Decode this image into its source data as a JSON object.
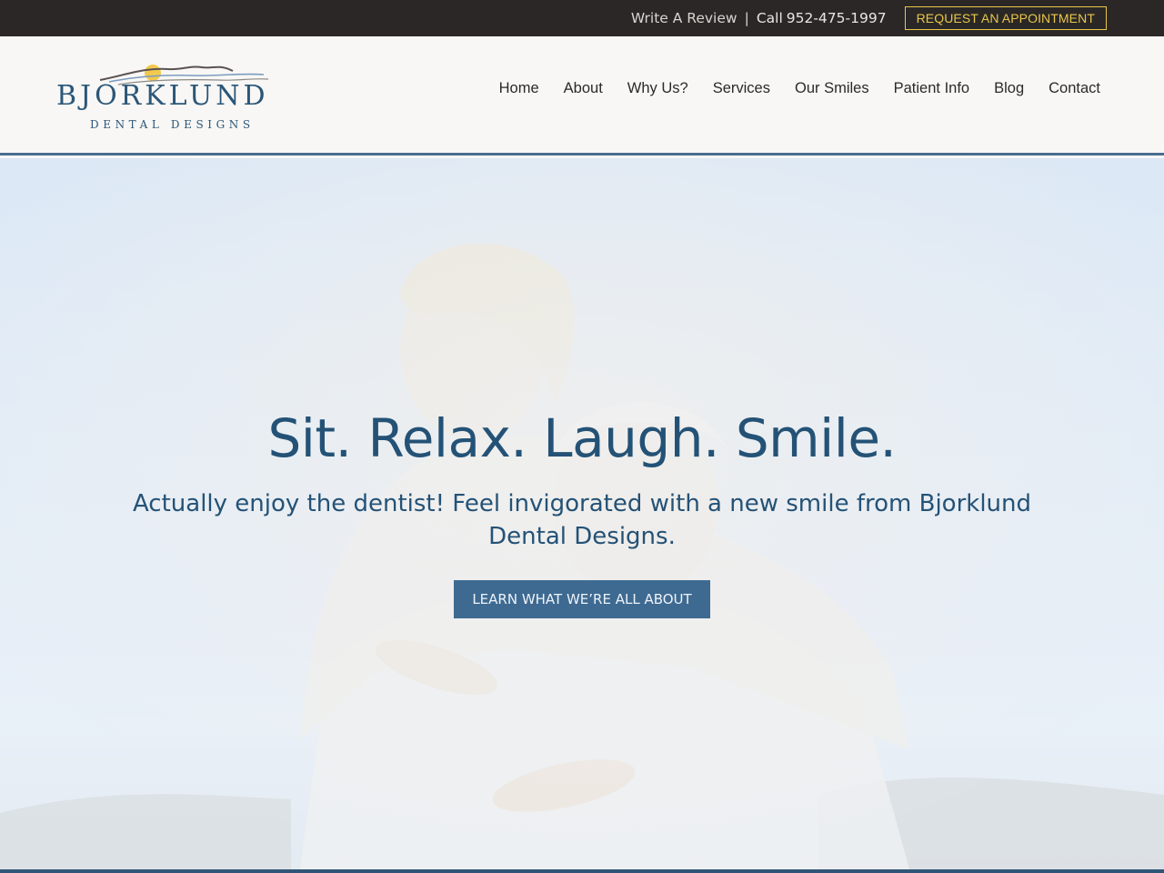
{
  "topbar": {
    "review_link": "Write A Review",
    "separator": "|",
    "call_label": "Call",
    "phone": "952-475-1997",
    "appointment_button": "REQUEST AN APPOINTMENT"
  },
  "brand": {
    "name": "BJORKLUND",
    "subtitle": "DENTAL DESIGNS",
    "logo_icon": "mountain-sun-logo",
    "accent_color": "#2b5678"
  },
  "nav": {
    "items": [
      {
        "label": "Home"
      },
      {
        "label": "About"
      },
      {
        "label": "Why Us?"
      },
      {
        "label": "Services"
      },
      {
        "label": "Our Smiles"
      },
      {
        "label": "Patient Info"
      },
      {
        "label": "Blog"
      },
      {
        "label": "Contact"
      }
    ]
  },
  "hero": {
    "title": "Sit. Relax. Laugh. Smile.",
    "subtitle": "Actually enjoy the dentist! Feel invigorated with a new smile from Bjorklund Dental Designs.",
    "cta": "LEARN WHAT WE’RE ALL ABOUT",
    "cta_color": "#3e6a92",
    "text_color": "#245276"
  },
  "colors": {
    "topbar_bg": "#2a2726",
    "appointment_accent": "#e8c64a",
    "header_rule": "#4a6d8f"
  }
}
